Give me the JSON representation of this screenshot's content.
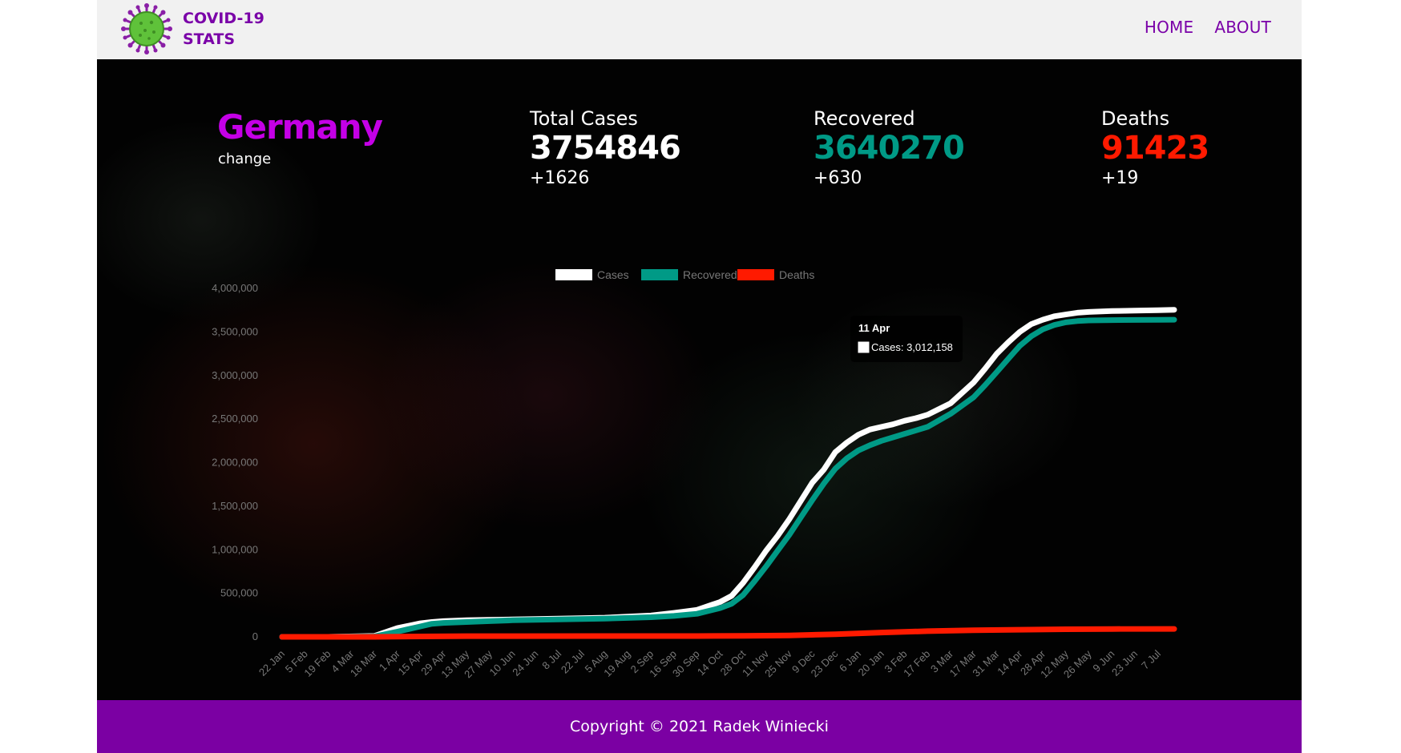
{
  "header": {
    "brand_line1": "COVID-19",
    "brand_line2": "STATS",
    "nav": [
      {
        "label": "HOME"
      },
      {
        "label": "ABOUT"
      }
    ]
  },
  "summary": {
    "country": "Germany",
    "change_label": "change",
    "total_cases": {
      "label": "Total Cases",
      "value": "3754846",
      "change": "+1626",
      "color": "#ffffff"
    },
    "recovered": {
      "label": "Recovered",
      "value": "3640270",
      "change": "+630",
      "color": "#009a86"
    },
    "deaths": {
      "label": "Deaths",
      "value": "91423",
      "change": "+19",
      "color": "#ff1a00"
    }
  },
  "colors": {
    "brand": "#7a00a8",
    "country": "#c400e6",
    "footer_bg": "#7b00a3",
    "cases_line": "#ffffff",
    "recovered_line": "#009a86",
    "deaths_line": "#ff1a00"
  },
  "chart_data": {
    "type": "line",
    "legend_position": "top-center",
    "grid": false,
    "ylim": [
      0,
      4000000
    ],
    "y_ticks": [
      0,
      500000,
      1000000,
      1500000,
      2000000,
      2500000,
      3000000,
      3500000,
      4000000
    ],
    "y_tick_labels": [
      "0",
      "500,000",
      "1,000,000",
      "1,500,000",
      "2,000,000",
      "2,500,000",
      "3,000,000",
      "3,500,000",
      "4,000,000"
    ],
    "x_tick_labels": [
      "22 Jan",
      "5 Feb",
      "19 Feb",
      "4 Mar",
      "18 Mar",
      "1 Apr",
      "15 Apr",
      "29 Apr",
      "13 May",
      "27 May",
      "10 Jun",
      "24 Jun",
      "8 Jul",
      "22 Jul",
      "5 Aug",
      "19 Aug",
      "2 Sep",
      "16 Sep",
      "30 Sep",
      "14 Oct",
      "28 Oct",
      "11 Nov",
      "25 Nov",
      "9 Dec",
      "23 Dec",
      "6 Jan",
      "20 Jan",
      "3 Feb",
      "17 Feb",
      "3 Mar",
      "17 Mar",
      "31 Mar",
      "14 Apr",
      "28 Apr",
      "12 May",
      "26 May",
      "9 Jun",
      "23 Jun",
      "7 Jul"
    ],
    "x_index_max": 38.7,
    "series": [
      {
        "name": "Cases",
        "color": "#ffffff",
        "x": [
          0,
          2,
          4,
          5,
          6,
          6.5,
          7,
          8,
          9,
          10,
          12,
          14,
          16,
          17,
          18,
          19,
          19.5,
          20,
          20.5,
          21,
          21.5,
          22,
          22.5,
          23,
          23.5,
          24,
          24.5,
          25,
          25.5,
          26,
          26.5,
          27,
          27.5,
          28,
          29,
          30,
          30.5,
          31,
          31.5,
          32,
          32.5,
          33,
          33.5,
          34,
          34.5,
          35,
          36,
          37,
          38,
          38.7
        ],
        "y": [
          0,
          0,
          10000,
          100000,
          155000,
          170000,
          180000,
          190000,
          195000,
          200000,
          210000,
          220000,
          245000,
          275000,
          310000,
          400000,
          470000,
          620000,
          800000,
          990000,
          1160000,
          1350000,
          1560000,
          1770000,
          1920000,
          2120000,
          2230000,
          2320000,
          2380000,
          2410000,
          2440000,
          2480000,
          2510000,
          2550000,
          2680000,
          2920000,
          3080000,
          3250000,
          3380000,
          3500000,
          3590000,
          3640000,
          3680000,
          3700000,
          3720000,
          3730000,
          3740000,
          3745000,
          3750000,
          3754846
        ]
      },
      {
        "name": "Recovered",
        "color": "#009a86",
        "x": [
          0,
          2,
          4,
          5,
          6,
          6.5,
          7,
          8,
          9,
          10,
          12,
          14,
          16,
          17,
          18,
          19,
          19.5,
          20,
          20.5,
          21,
          21.5,
          22,
          22.5,
          23,
          23.5,
          24,
          24.5,
          25,
          25.5,
          26,
          26.5,
          27,
          27.5,
          28,
          29,
          30,
          30.5,
          31,
          31.5,
          32,
          32.5,
          33,
          33.5,
          34,
          34.5,
          35,
          36,
          37,
          38,
          38.7
        ],
        "y": [
          0,
          0,
          5000,
          60000,
          120000,
          150000,
          160000,
          170000,
          180000,
          190000,
          200000,
          210000,
          225000,
          240000,
          265000,
          330000,
          380000,
          480000,
          640000,
          810000,
          990000,
          1170000,
          1370000,
          1570000,
          1760000,
          1930000,
          2050000,
          2140000,
          2200000,
          2250000,
          2290000,
          2330000,
          2370000,
          2410000,
          2560000,
          2750000,
          2890000,
          3040000,
          3190000,
          3340000,
          3450000,
          3530000,
          3580000,
          3610000,
          3625000,
          3632000,
          3636000,
          3638000,
          3639500,
          3640270
        ]
      },
      {
        "name": "Deaths",
        "color": "#ff1a00",
        "x": [
          0,
          4,
          6,
          8,
          14,
          18,
          20,
          22,
          24,
          26,
          28,
          30,
          32,
          34,
          36,
          38.7
        ],
        "y": [
          0,
          100,
          5000,
          8000,
          9000,
          9500,
          11000,
          16000,
          30000,
          50000,
          65000,
          76000,
          82000,
          87000,
          90000,
          91423
        ]
      }
    ],
    "tooltip": {
      "title": "11 Apr",
      "text": "Cases: 3,012,158",
      "series": "Cases",
      "x": 30.7,
      "y": 3012158
    }
  },
  "footer": {
    "copyright": "Copyright © 2021 Radek Winiecki"
  }
}
